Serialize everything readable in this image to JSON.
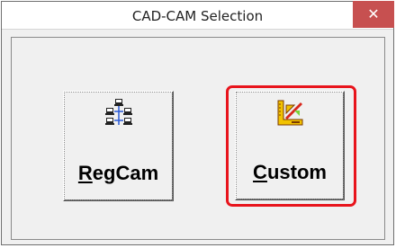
{
  "window": {
    "title": "CAD-CAM Selection",
    "close_glyph": "✕"
  },
  "buttons": [
    {
      "label_first": "R",
      "label_rest": "egCam",
      "icon": "network-icon"
    },
    {
      "label_first": "C",
      "label_rest": "ustom",
      "icon": "drafting-tools-icon"
    }
  ],
  "colors": {
    "close_bg": "#c75050",
    "highlight": "#e8141c"
  }
}
